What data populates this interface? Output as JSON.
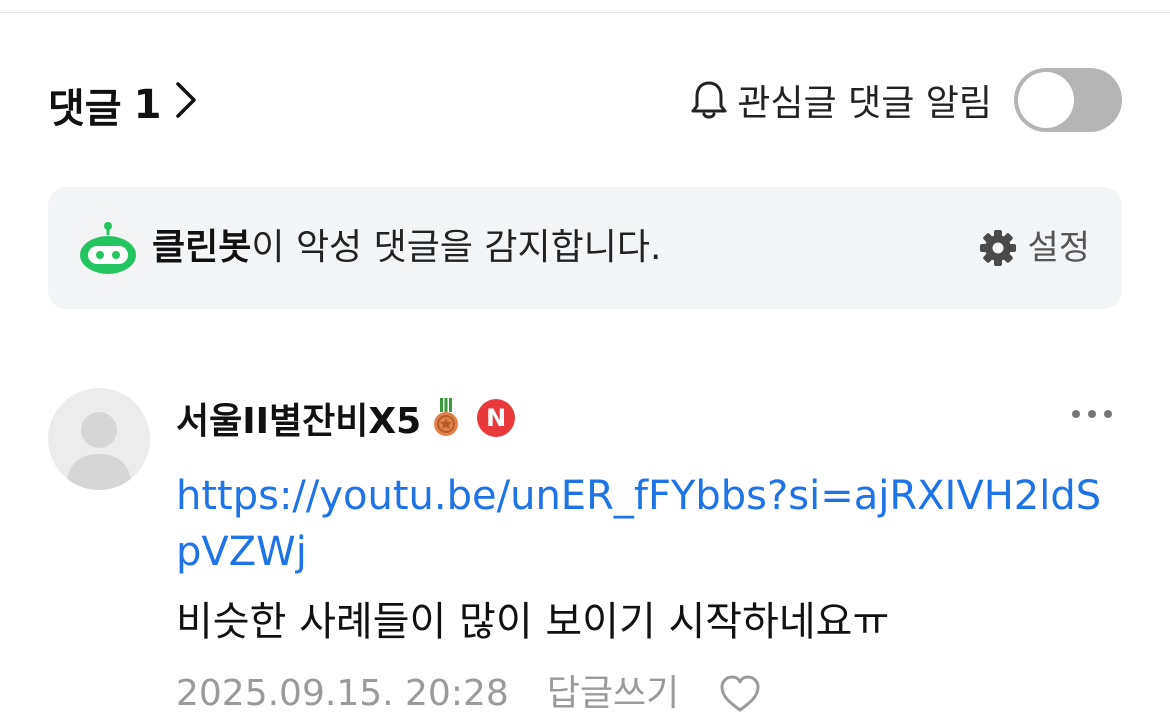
{
  "comments_header": {
    "title": "댓글",
    "count": "1",
    "notify_label": "관심글 댓글 알림",
    "notify_enabled": false
  },
  "cleanbot": {
    "brand": "클린봇",
    "message": "이 악성 댓글을 감지합니다.",
    "settings_label": "설정",
    "accent_color": "#22c55e"
  },
  "comment": {
    "author": "서울II별잔비X5",
    "badge_letter": "N",
    "link": "https://youtu.be/unER_fFYbbs?si=ajRXIVH2ldSpVZWj",
    "text": "비슷한 사례들이 많이 보이기 시작하네요ㅠ",
    "timestamp": "2025.09.15. 20:28",
    "reply_label": "답글쓰기"
  },
  "icons": [
    "chevron-right-icon",
    "bell-icon",
    "robot-icon",
    "gear-icon",
    "medal-icon",
    "more-icon",
    "heart-icon"
  ]
}
